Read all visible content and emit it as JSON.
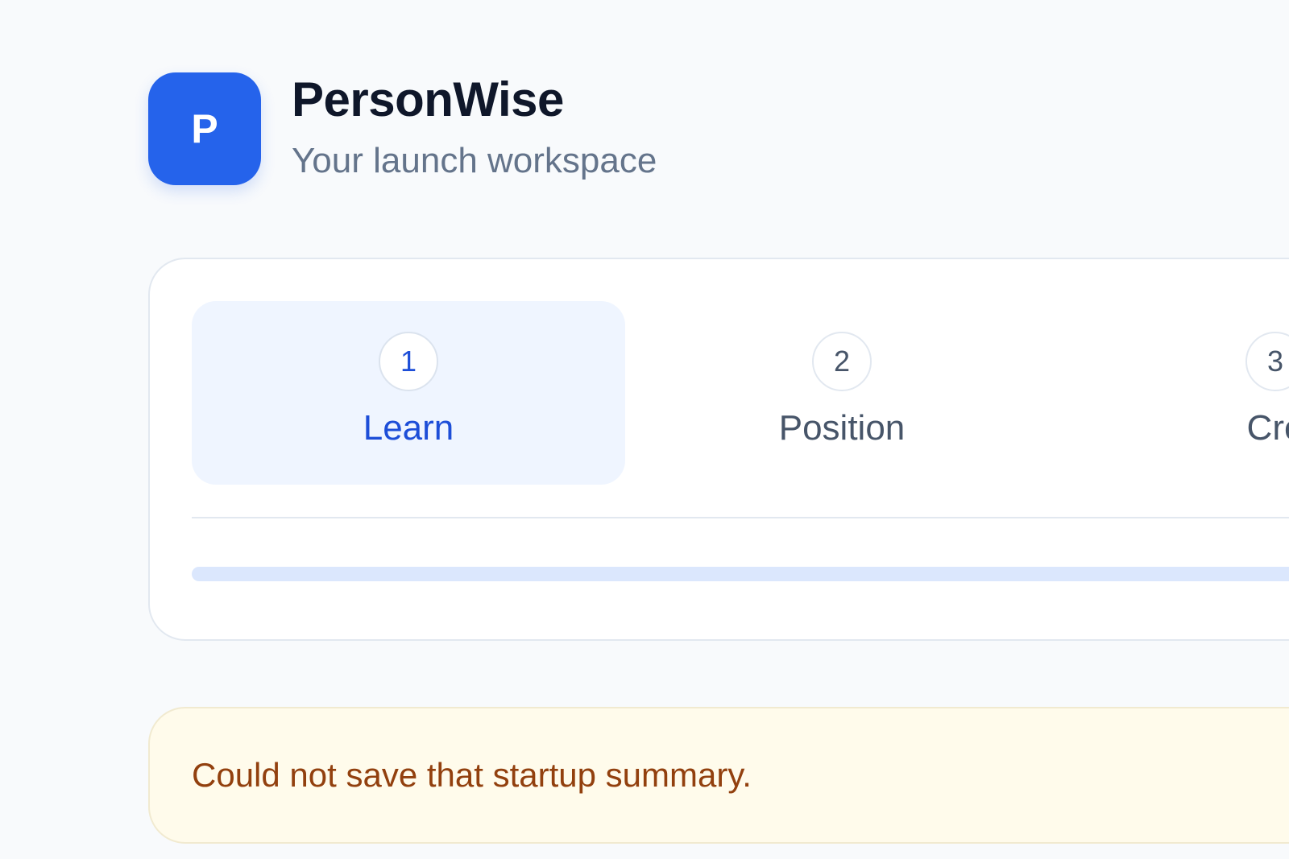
{
  "app": {
    "logo_letter": "P",
    "name": "PersonWise",
    "subtitle": "Your launch workspace",
    "accent_color": "#2563eb"
  },
  "stepper": {
    "steps": [
      {
        "number": "1",
        "label": "Learn",
        "active": true
      },
      {
        "number": "2",
        "label": "Position",
        "active": false
      },
      {
        "number": "3",
        "label": "Cre",
        "active": false
      }
    ],
    "progress": 0
  },
  "alert": {
    "message": "Could not save that startup summary.",
    "color": "#92400e",
    "background": "#fffbeb"
  }
}
